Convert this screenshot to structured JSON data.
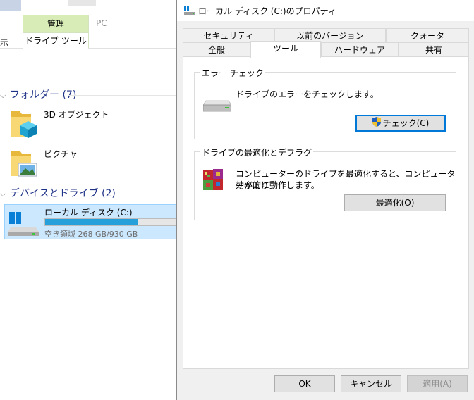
{
  "explorer": {
    "ribbon": {
      "context_group": "管理",
      "context_tab": "ドライブ ツール",
      "pc_tab": "PC",
      "view_tab": "示"
    },
    "folders_group": {
      "label": "フォルダー (7)"
    },
    "folders": [
      {
        "name": "3D オブジェクト",
        "icon": "3d-objects-folder-icon"
      },
      {
        "name": "ピクチャ",
        "icon": "pictures-folder-icon"
      }
    ],
    "devices_group": {
      "label": "デバイスとドライブ (2)"
    },
    "drive": {
      "name": "ローカル ディスク (C:)",
      "space_text": "空き領域 268 GB/930 GB",
      "used_fraction": 0.712,
      "icon": "local-disk-icon"
    }
  },
  "dialog": {
    "title": "ローカル ディスク (C:)のプロパティ",
    "tabs_back": [
      {
        "label": "セキュリティ"
      },
      {
        "label": "以前のバージョン"
      },
      {
        "label": "クォータ"
      }
    ],
    "tabs_front": [
      {
        "label": "全般"
      },
      {
        "label": "ツール",
        "active": true
      },
      {
        "label": "ハードウェア"
      },
      {
        "label": "共有"
      }
    ],
    "error_check": {
      "legend": "エラー チェック",
      "description": "ドライブのエラーをチェックします。",
      "button": "チェック(C)"
    },
    "optimize": {
      "legend": "ドライブの最適化とデフラグ",
      "description_line1": "コンピューターのドライブを最適化すると、コンピューターがより",
      "description_line2": "効率的に動作します。",
      "button": "最適化(O)"
    },
    "buttons": {
      "ok": "OK",
      "cancel": "キャンセル",
      "apply": "適用(A)"
    }
  },
  "colors": {
    "accent": "#0078d7",
    "selection": "#cce8ff",
    "progress": "#26a0da",
    "group_header": "#1e3287"
  }
}
